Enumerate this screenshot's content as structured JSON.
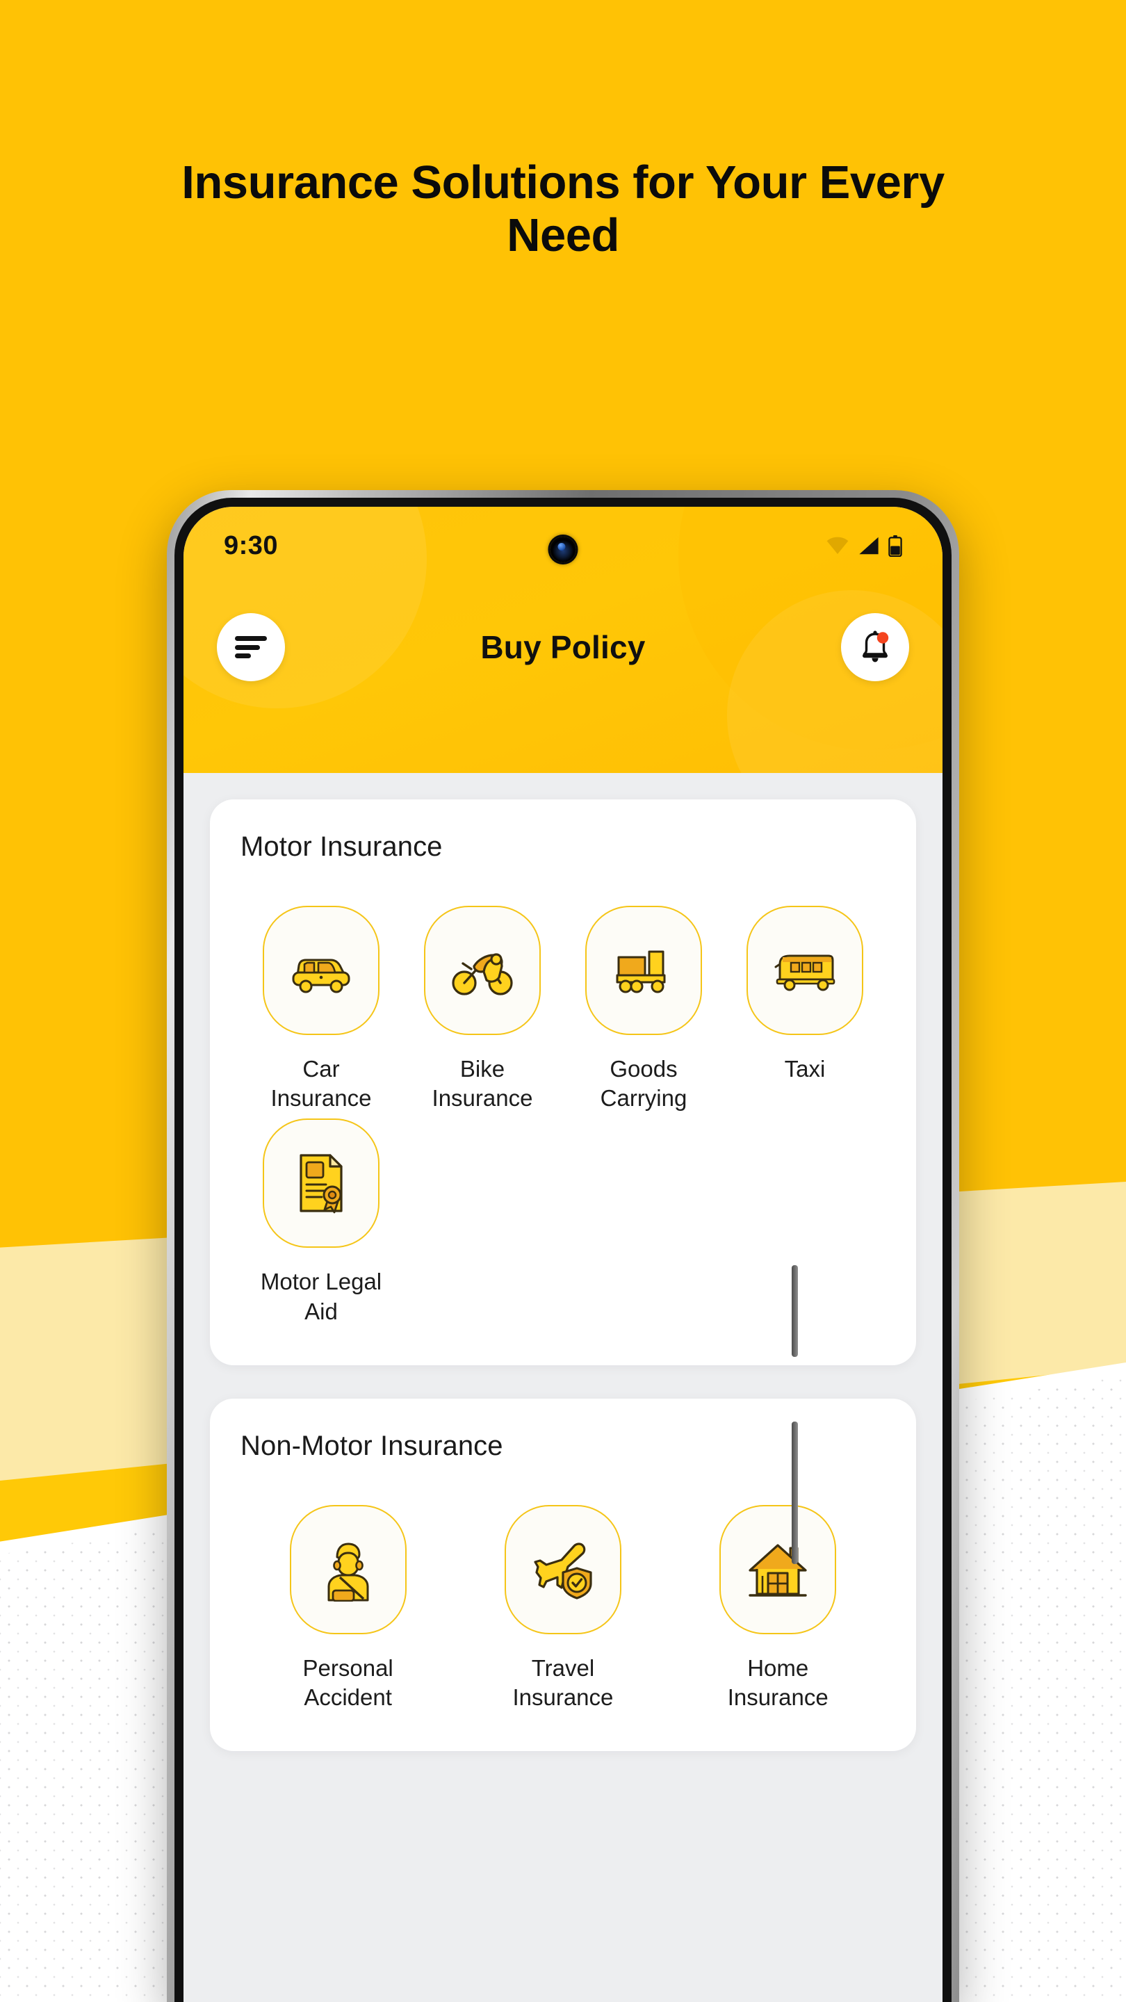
{
  "promo": {
    "headline": "Insurance Solutions for Your Every Need",
    "background_color": "#FFC907",
    "band_color": "#FCE9A8"
  },
  "device": {
    "status_bar": {
      "time": "9:30",
      "icons": [
        "wifi-icon",
        "signal-icon",
        "battery-icon"
      ],
      "battery_level_percent": 50
    },
    "camera": "front-camera-punch-hole"
  },
  "appbar": {
    "menu_icon": "hamburger-menu-icon",
    "title": "Buy Policy",
    "notification_icon": "bell-icon",
    "notification_badge": true,
    "badge_color": "#F4441E",
    "background_color": "#FFC707"
  },
  "theme": {
    "accent": "#F5C518",
    "icon_fill": "#FFD21E",
    "icon_fill_dark": "#F0A91C",
    "screen_bg": "#EDEEF0",
    "card_bg": "#FFFFFF",
    "tile_bg": "#FDFCF7",
    "text": "#1C1C1C"
  },
  "sections": [
    {
      "title": "Motor Insurance",
      "columns": 4,
      "items": [
        {
          "label": "Car Insurance",
          "icon": "car-icon"
        },
        {
          "label": "Bike Insurance",
          "icon": "motorbike-icon"
        },
        {
          "label": "Goods Carrying",
          "icon": "truck-icon"
        },
        {
          "label": "Taxi",
          "icon": "bus-icon"
        },
        {
          "label": "Motor Legal Aid",
          "icon": "certificate-document-icon"
        }
      ]
    },
    {
      "title": "Non-Motor Insurance",
      "columns": 3,
      "items": [
        {
          "label": "Personal Accident",
          "icon": "injured-person-icon"
        },
        {
          "label": "Travel Insurance",
          "icon": "airplane-shield-icon"
        },
        {
          "label": "Home Insurance",
          "icon": "house-icon"
        }
      ]
    }
  ]
}
